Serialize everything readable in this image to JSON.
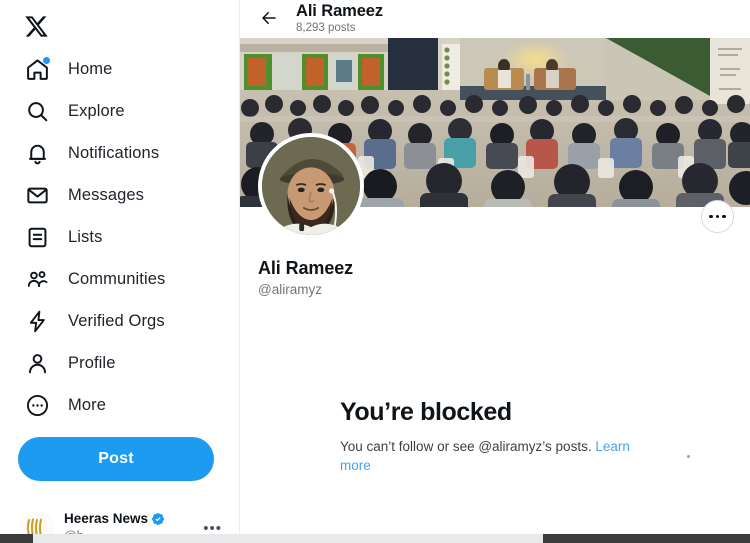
{
  "app": {
    "brand_icon": "x-logo-icon",
    "accent_color": "#1d9bf0"
  },
  "sidebar": {
    "items": [
      {
        "label": "Home",
        "icon": "home-icon",
        "badge_dot": true
      },
      {
        "label": "Explore",
        "icon": "search-icon",
        "badge_dot": false
      },
      {
        "label": "Notifications",
        "icon": "bell-icon",
        "badge_dot": false
      },
      {
        "label": "Messages",
        "icon": "envelope-icon",
        "badge_dot": false
      },
      {
        "label": "Lists",
        "icon": "list-icon",
        "badge_dot": false
      },
      {
        "label": "Communities",
        "icon": "people-icon",
        "badge_dot": false
      },
      {
        "label": "Verified Orgs",
        "icon": "lightning-icon",
        "badge_dot": false
      },
      {
        "label": "Profile",
        "icon": "person-icon",
        "badge_dot": false
      },
      {
        "label": "More",
        "icon": "more-circle-icon",
        "badge_dot": false
      }
    ],
    "post_button": "Post",
    "account": {
      "name": "Heeras News",
      "handle": "@h",
      "verified": true,
      "more_glyph": "•••",
      "avatar_icon": "avatar-image"
    }
  },
  "header": {
    "back_icon": "back-arrow-icon",
    "title": "Ali Rameez",
    "posts_count": "8,293 posts"
  },
  "profile": {
    "banner_icon": "banner-photo",
    "avatar_icon": "profile-photo",
    "name": "Ali Rameez",
    "handle": "@aliramyz",
    "more_options_label": "More options"
  },
  "blocked": {
    "title": "You’re blocked",
    "description": "You can’t follow or see @aliramyz’s posts.",
    "link_text": "Learn more",
    "link_color": "#4aa3e8"
  }
}
